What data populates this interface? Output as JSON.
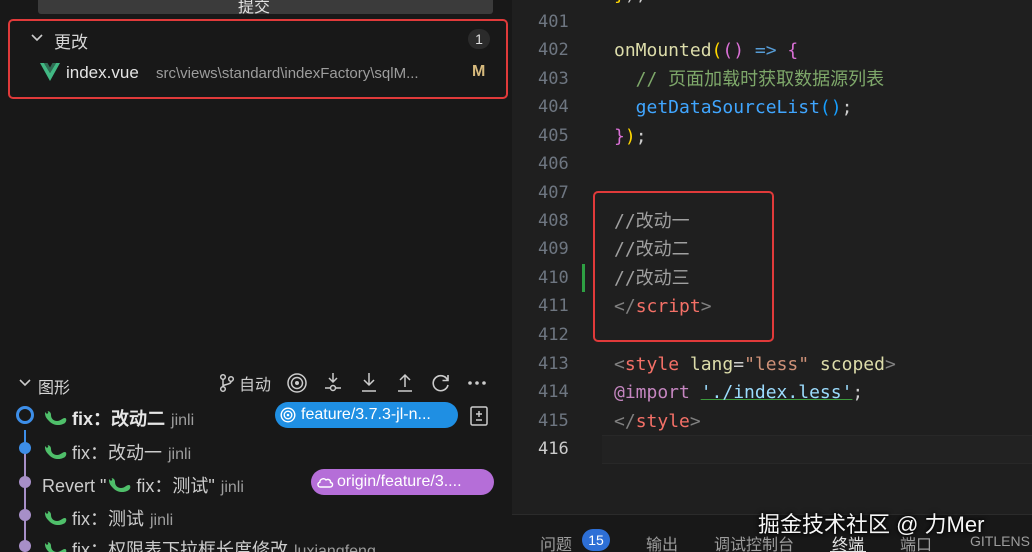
{
  "commit_button": {
    "label": "提交"
  },
  "changes": {
    "title": "更改",
    "count": "1",
    "file": {
      "name": "index.vue",
      "path": "src\\views\\standard\\indexFactory\\sqlM...",
      "status": "M"
    }
  },
  "graph": {
    "title": "图形",
    "auto_label": "自动",
    "icons": [
      "branch-icon",
      "target-icon",
      "fetch-icon",
      "pull-icon",
      "push-icon",
      "refresh-icon",
      "more-icon"
    ],
    "commits": [
      {
        "message": "fix：改动二",
        "author": "jinli",
        "branch": "feature/3.7.3-jl-n..."
      },
      {
        "message": "fix：改动一",
        "author": "jinli"
      },
      {
        "prefix": "Revert \"",
        "message": "fix：测试\"",
        "author": "jinli",
        "branch": "origin/feature/3...."
      },
      {
        "message": "fix：测试",
        "author": "jinli"
      },
      {
        "message": "fix：权限表下拉框长度修改",
        "author": "luxiangfeng"
      }
    ]
  },
  "editor": {
    "lines": [
      {
        "n": "401"
      },
      {
        "n": "402"
      },
      {
        "n": "403"
      },
      {
        "n": "404"
      },
      {
        "n": "405"
      },
      {
        "n": "406"
      },
      {
        "n": "407"
      },
      {
        "n": "408"
      },
      {
        "n": "409"
      },
      {
        "n": "410"
      },
      {
        "n": "411"
      },
      {
        "n": "412"
      },
      {
        "n": "413"
      },
      {
        "n": "414"
      },
      {
        "n": "415"
      },
      {
        "n": "416"
      }
    ],
    "code": {
      "l402a": "onMounted",
      "l402b": "(",
      "l402c": "() ",
      "l402d": "=>",
      "l402e": " {",
      "l403": "  // 页面加载时获取数据源列表",
      "l404a": "  getDataSourceList",
      "l404b": "()",
      "l404c": ";",
      "l405a": "}",
      "l405b": ")",
      "l405c": ";",
      "l408": "//改动一",
      "l409": "//改动二",
      "l410": "//改动三",
      "l411a": "</",
      "l411b": "script",
      "l411c": ">",
      "l413a": "<",
      "l413b": "style",
      "l413c": " lang",
      "l413d": "=",
      "l413e": "\"less\"",
      "l413f": " scoped",
      "l413g": ">",
      "l414a": "@import",
      "l414b": " ",
      "l414c": "'./index.less'",
      "l414d": ";",
      "l415a": "</",
      "l415b": "style",
      "l415c": ">"
    }
  },
  "panel": {
    "tabs": {
      "problems": "问题",
      "problems_count": "15",
      "output": "输出",
      "debug": "调试控制台",
      "terminal": "终端",
      "ports": "端口",
      "gitlens": "GITLENS"
    }
  },
  "watermark": "掘金技术社区 @ 力Mer"
}
